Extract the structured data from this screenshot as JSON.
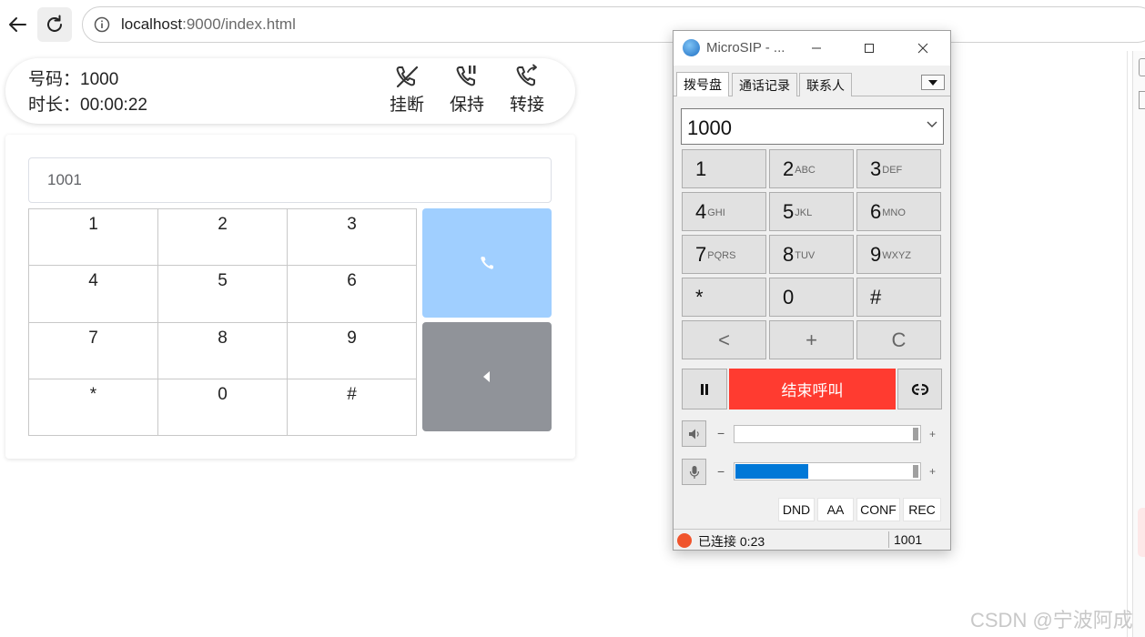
{
  "browser": {
    "url_host": "localhost",
    "url_rest": ":9000/index.html",
    "icons": [
      "back-icon",
      "reload-icon",
      "info-icon"
    ]
  },
  "call": {
    "number_label": "号码：",
    "number": "1000",
    "duration_label": "时长：",
    "duration": "00:00:22",
    "actions": [
      {
        "label": "挂断",
        "icon": "hangup-icon"
      },
      {
        "label": "保持",
        "icon": "hold-icon"
      },
      {
        "label": "转接",
        "icon": "transfer-icon"
      }
    ]
  },
  "dialer": {
    "input_value": "1001",
    "keys": [
      "1",
      "2",
      "3",
      "4",
      "5",
      "6",
      "7",
      "8",
      "9",
      "*",
      "0",
      "#"
    ],
    "call_button_color": "#a0cfff",
    "backspace_button_color": "#909399",
    "icons": [
      "phone-icon",
      "backspace-icon"
    ]
  },
  "microsip": {
    "title": "MicroSIP - ...",
    "tabs": [
      "拨号盘",
      "通话记录",
      "联系人"
    ],
    "number": "1000",
    "keys": [
      {
        "digit": "1",
        "sub": ""
      },
      {
        "digit": "2",
        "sub": "ABC"
      },
      {
        "digit": "3",
        "sub": "DEF"
      },
      {
        "digit": "4",
        "sub": "GHI"
      },
      {
        "digit": "5",
        "sub": "JKL"
      },
      {
        "digit": "6",
        "sub": "MNO"
      },
      {
        "digit": "7",
        "sub": "PQRS"
      },
      {
        "digit": "8",
        "sub": "TUV"
      },
      {
        "digit": "9",
        "sub": "WXYZ"
      },
      {
        "digit": "*",
        "sub": ""
      },
      {
        "digit": "0",
        "sub": ""
      },
      {
        "digit": "#",
        "sub": ""
      },
      {
        "digit": "<",
        "sub": ""
      },
      {
        "digit": "+",
        "sub": ""
      },
      {
        "digit": "C",
        "sub": ""
      }
    ],
    "end_call_label": "结束呼叫",
    "end_call_color": "#ff3b30",
    "speaker_volume_level": 1.0,
    "mic_volume_level": 0.41,
    "minus": "−",
    "plus": "+",
    "buttons": [
      "DND",
      "AA",
      "CONF",
      "REC"
    ],
    "status_text": "已连接 0:23",
    "status_account": "1001",
    "accent_color": "#0078d7"
  },
  "watermark": "CSDN @宁波阿成"
}
